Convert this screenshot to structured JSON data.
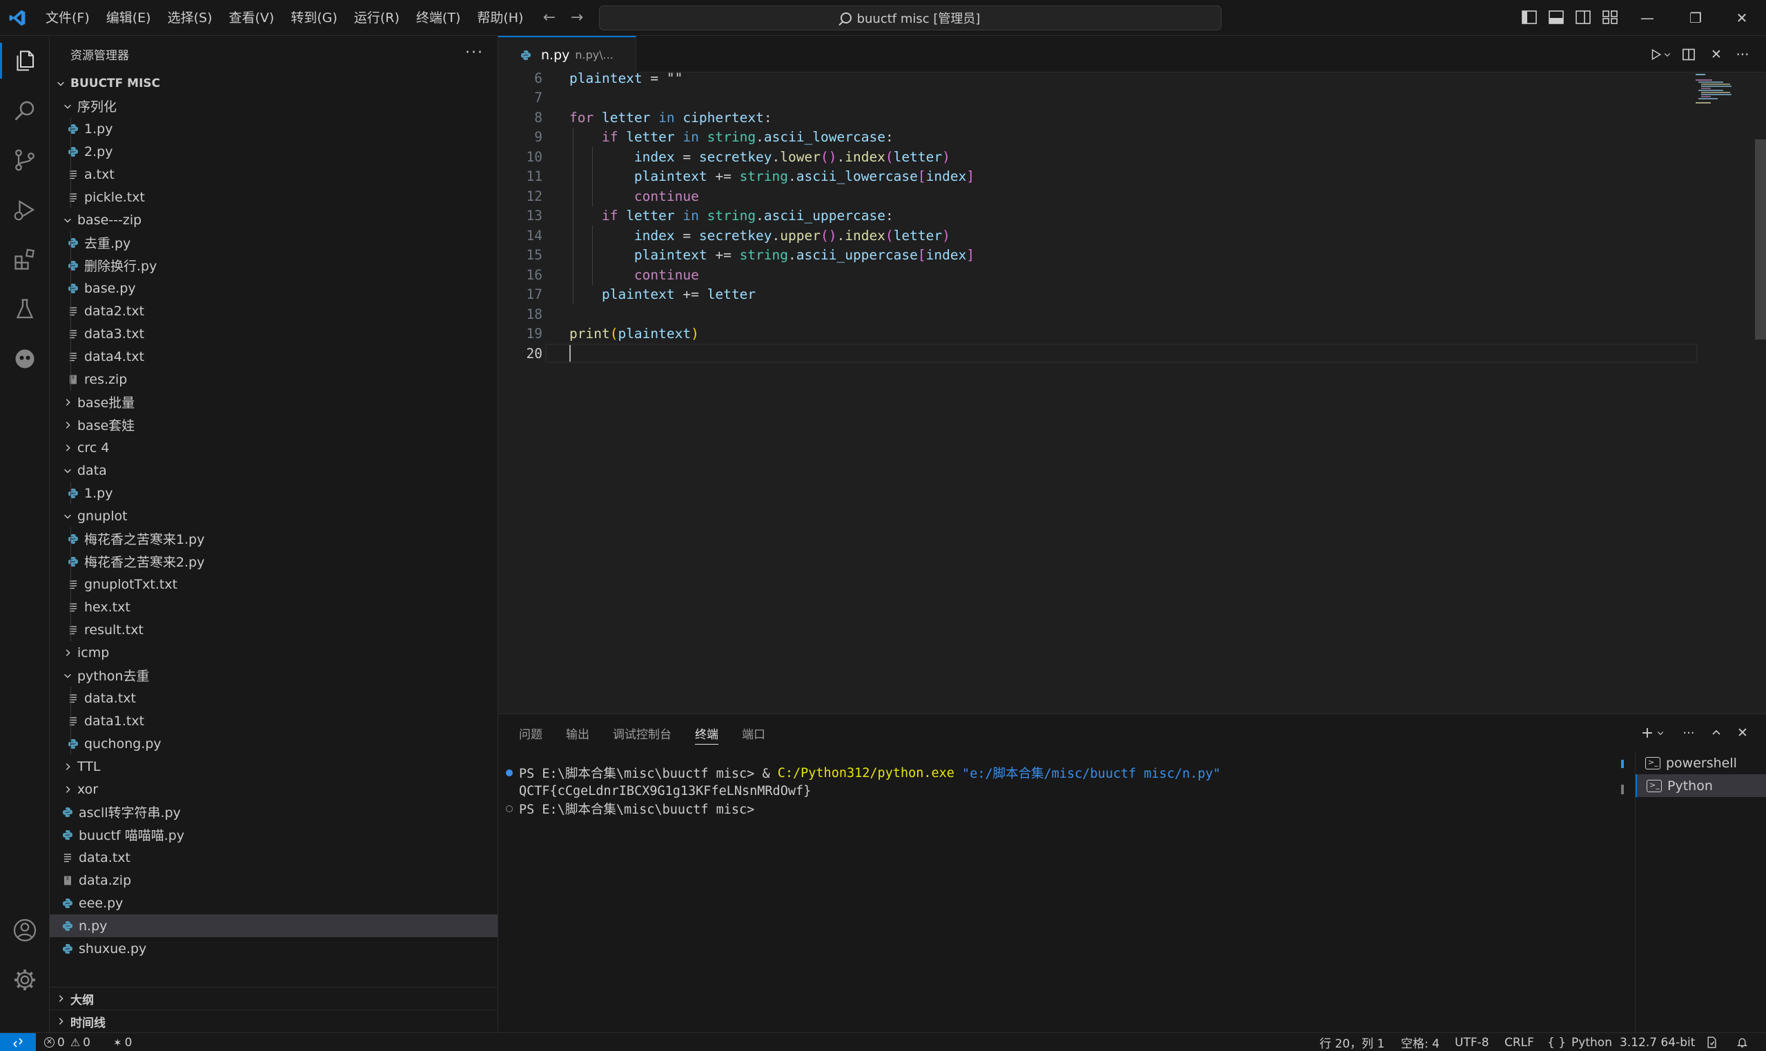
{
  "title_bar": {
    "menus": [
      "文件(F)",
      "编辑(E)",
      "选择(S)",
      "查看(V)",
      "转到(G)",
      "运行(R)",
      "终端(T)",
      "帮助(H)"
    ],
    "search_text": "buuctf misc [管理员]"
  },
  "sidebar": {
    "title": "资源管理器",
    "more": "···",
    "folder": "BUUCTF MISC",
    "tree": [
      {
        "label": "序列化",
        "kind": "folder",
        "depth": 1,
        "open": true
      },
      {
        "label": "1.py",
        "kind": "py",
        "depth": 2
      },
      {
        "label": "2.py",
        "kind": "py",
        "depth": 2
      },
      {
        "label": "a.txt",
        "kind": "txt",
        "depth": 2
      },
      {
        "label": "pickle.txt",
        "kind": "txt",
        "depth": 2
      },
      {
        "label": "base---zip",
        "kind": "folder",
        "depth": 1,
        "open": true
      },
      {
        "label": "去重.py",
        "kind": "py",
        "depth": 2
      },
      {
        "label": "删除换行.py",
        "kind": "py",
        "depth": 2
      },
      {
        "label": "base.py",
        "kind": "py",
        "depth": 2
      },
      {
        "label": "data2.txt",
        "kind": "txt",
        "depth": 2
      },
      {
        "label": "data3.txt",
        "kind": "txt",
        "depth": 2
      },
      {
        "label": "data4.txt",
        "kind": "txt",
        "depth": 2
      },
      {
        "label": "res.zip",
        "kind": "zip",
        "depth": 2
      },
      {
        "label": "base批量",
        "kind": "folder",
        "depth": 1,
        "open": false
      },
      {
        "label": "base套娃",
        "kind": "folder",
        "depth": 1,
        "open": false
      },
      {
        "label": "crc 4",
        "kind": "folder",
        "depth": 1,
        "open": false
      },
      {
        "label": "data",
        "kind": "folder",
        "depth": 1,
        "open": true
      },
      {
        "label": "1.py",
        "kind": "py",
        "depth": 2
      },
      {
        "label": "gnuplot",
        "kind": "folder",
        "depth": 1,
        "open": true
      },
      {
        "label": "梅花香之苦寒来1.py",
        "kind": "py",
        "depth": 2
      },
      {
        "label": "梅花香之苦寒来2.py",
        "kind": "py",
        "depth": 2
      },
      {
        "label": "gnuplotTxt.txt",
        "kind": "txt",
        "depth": 2
      },
      {
        "label": "hex.txt",
        "kind": "txt",
        "depth": 2
      },
      {
        "label": "result.txt",
        "kind": "txt",
        "depth": 2
      },
      {
        "label": "icmp",
        "kind": "folder",
        "depth": 1,
        "open": false
      },
      {
        "label": "python去重",
        "kind": "folder",
        "depth": 1,
        "open": true
      },
      {
        "label": "data.txt",
        "kind": "txt",
        "depth": 2
      },
      {
        "label": "data1.txt",
        "kind": "txt",
        "depth": 2
      },
      {
        "label": "quchong.py",
        "kind": "py",
        "depth": 2
      },
      {
        "label": "TTL",
        "kind": "folder",
        "depth": 1,
        "open": false
      },
      {
        "label": "xor",
        "kind": "folder",
        "depth": 1,
        "open": false
      },
      {
        "label": "ascll转字符串.py",
        "kind": "py",
        "depth": 0
      },
      {
        "label": "buuctf 喵喵喵.py",
        "kind": "py",
        "depth": 0
      },
      {
        "label": "data.txt",
        "kind": "txt",
        "depth": 0
      },
      {
        "label": "data.zip",
        "kind": "zip",
        "depth": 0
      },
      {
        "label": "eee.py",
        "kind": "py",
        "depth": 0
      },
      {
        "label": "n.py",
        "kind": "py",
        "depth": 0,
        "selected": true
      },
      {
        "label": "shuxue.py",
        "kind": "py",
        "depth": 0
      }
    ],
    "outline": "大纲",
    "timeline": "时间线"
  },
  "editor": {
    "tab_name": "n.py",
    "tab_desc": "n.py\\...",
    "current_line": "20",
    "lines": [
      {
        "n": "6",
        "html": "<span class='var'>plaintext</span> <span class='op'>=</span> <span class='op'>\"\"</span>"
      },
      {
        "n": "7",
        "html": ""
      },
      {
        "n": "8",
        "html": "<span class='kw2'>for</span> <span class='var'>letter</span> <span class='kw'>in</span> <span class='var'>ciphertext</span>:"
      },
      {
        "n": "9",
        "html": "    <span class='kw2'>if</span> <span class='var'>letter</span> <span class='kw'>in</span> <span class='mod'>string</span>.<span class='var'>ascii_lowercase</span>:"
      },
      {
        "n": "10",
        "html": "        <span class='var'>index</span> = <span class='var'>secretkey</span>.<span class='fn'>lower</span><span class='paren2'>()</span>.<span class='fn'>index</span><span class='paren2'>(</span><span class='var'>letter</span><span class='paren2'>)</span>"
      },
      {
        "n": "11",
        "html": "        <span class='var'>plaintext</span> += <span class='mod'>string</span>.<span class='var'>ascii_lowercase</span><span class='paren2'>[</span><span class='var'>index</span><span class='paren2'>]</span>"
      },
      {
        "n": "12",
        "html": "        <span class='kw2'>continue</span>"
      },
      {
        "n": "13",
        "html": "    <span class='kw2'>if</span> <span class='var'>letter</span> <span class='kw'>in</span> <span class='mod'>string</span>.<span class='var'>ascii_uppercase</span>:"
      },
      {
        "n": "14",
        "html": "        <span class='var'>index</span> = <span class='var'>secretkey</span>.<span class='fn'>upper</span><span class='paren2'>()</span>.<span class='fn'>index</span><span class='paren2'>(</span><span class='var'>letter</span><span class='paren2'>)</span>"
      },
      {
        "n": "15",
        "html": "        <span class='var'>plaintext</span> += <span class='mod'>string</span>.<span class='var'>ascii_uppercase</span><span class='paren2'>[</span><span class='var'>index</span><span class='paren2'>]</span>"
      },
      {
        "n": "16",
        "html": "        <span class='kw2'>continue</span>"
      },
      {
        "n": "17",
        "html": "    <span class='var'>plaintext</span> += <span class='var'>letter</span>"
      },
      {
        "n": "18",
        "html": ""
      },
      {
        "n": "19",
        "html": "<span class='fn'>print</span><span class='paren'>(</span><span class='var'>plaintext</span><span class='paren'>)</span>"
      },
      {
        "n": "20",
        "html": ""
      }
    ]
  },
  "panel": {
    "tabs": [
      "问题",
      "输出",
      "调试控制台",
      "终端",
      "端口"
    ],
    "active_tab": "终端",
    "terminal": {
      "line1_prompt": "PS E:\\脚本合集\\misc\\buuctf misc> & ",
      "line1_exe": "C:/Python312/python.exe",
      "line1_arg": " \"e:/脚本合集/misc/buuctf misc/n.py\"",
      "line2": "QCTF{cCgeLdnrIBCX9G1g13KFfeLNsnMRdOwf}",
      "line3": "PS E:\\脚本合集\\misc\\buuctf misc>"
    },
    "terminals": [
      "powershell",
      "Python"
    ],
    "active_terminal": "Python"
  },
  "status_bar": {
    "errors": "0",
    "warnings": "0",
    "ports": "0",
    "position": "行 20，列 1",
    "spaces": "空格: 4",
    "encoding": "UTF-8",
    "eol": "CRLF",
    "language": "Python",
    "interpreter": "3.12.7 64-bit"
  },
  "colors": {
    "accent": "#0078d4",
    "python_icon": "#519aba",
    "background": "#1f1f1f"
  }
}
